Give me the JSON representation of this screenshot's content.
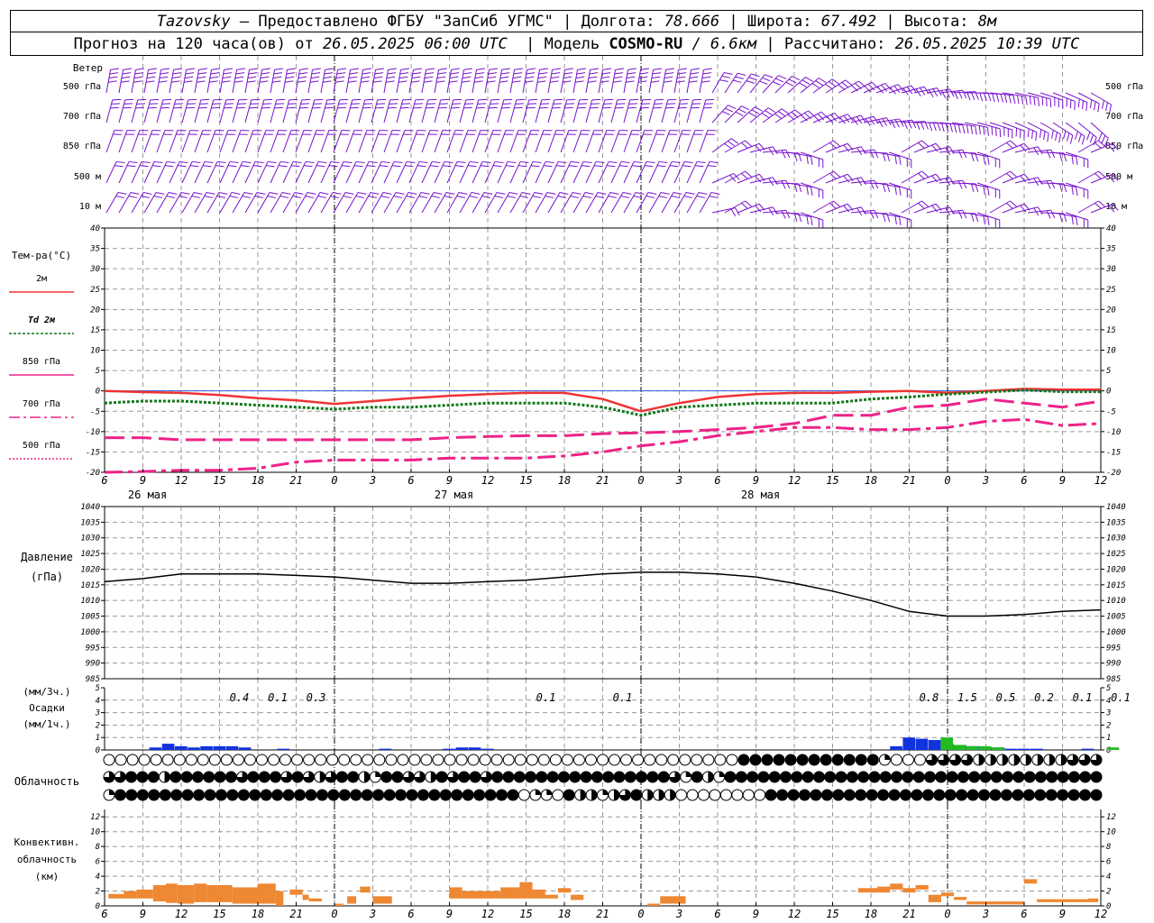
{
  "header": {
    "station": "Tazovsky",
    "provided_by": "– Предоставлено ФГБУ \"ЗапСиб УГМС\"",
    "lon_label": "Долгота:",
    "lon_value": "78.666",
    "lat_label": "Широта:",
    "lat_value": "67.492",
    "alt_label": "Высота:",
    "alt_value": "8м",
    "forecast_label": "Прогноз на 120 часа(ов) от",
    "forecast_start": "26.05.2025 06:00 UTC",
    "model_label": "Модель",
    "model_name": "COSMO-RU",
    "model_res": "/ 6.6км",
    "calc_label": "Рассчитано:",
    "calc_time": "26.05.2025 10:39 UTC"
  },
  "colors": {
    "t2m": "#ee3333",
    "td2m": "#11771a",
    "t_upper": "#ee2288",
    "wind": "#7711cc",
    "pressure": "#000000",
    "precip_3h": "#1133dd",
    "precip_1h": "#22bb22",
    "convective": "#ee8833"
  },
  "chart_data": [
    {
      "type": "wind_barbs",
      "title": "Ветер",
      "levels": [
        "500 гПа",
        "700 гПа",
        "850 гПа",
        "500 м",
        "10  м"
      ]
    },
    {
      "type": "line",
      "title": "Тем-ра(°C)",
      "ylim": [
        -20,
        40
      ],
      "yticks": [
        -20,
        -15,
        -10,
        -5,
        0,
        5,
        10,
        15,
        20,
        25,
        30,
        35,
        40
      ],
      "xtick_labels": [
        "6",
        "9",
        "12",
        "15",
        "18",
        "21",
        "0",
        "3",
        "6",
        "9",
        "12",
        "15",
        "18",
        "21",
        "0",
        "3",
        "6",
        "9",
        "12",
        "15",
        "18",
        "21",
        "0",
        "3",
        "6",
        "9",
        "12"
      ],
      "day_labels": [
        "26 мая",
        "27 мая",
        "28 мая"
      ],
      "x_hours": [
        0,
        3,
        6,
        9,
        12,
        15,
        18,
        21,
        24,
        27,
        30,
        33,
        36,
        39,
        42,
        45,
        48,
        51,
        54,
        57,
        60,
        63,
        66,
        69,
        72,
        75,
        78
      ],
      "series": [
        {
          "name": "2м",
          "values": [
            0,
            -0.3,
            -0.5,
            -1,
            -1.8,
            -2.3,
            -3.2,
            -2.5,
            -1.8,
            -1.2,
            -0.8,
            -0.5,
            -0.5,
            -2,
            -5,
            -3,
            -1.5,
            -0.8,
            -0.5,
            -0.5,
            -0.2,
            0,
            -0.5,
            0,
            0.5,
            0.3,
            0.3
          ]
        },
        {
          "name": "Td 2м",
          "values": [
            -3,
            -2.5,
            -2.5,
            -3,
            -3.5,
            -4,
            -4.5,
            -4,
            -4,
            -3.5,
            -3,
            -3,
            -3,
            -4,
            -6,
            -4,
            -3.5,
            -3,
            -3,
            -3,
            -2,
            -1.5,
            -0.8,
            -0.3,
            0.2,
            -0.2,
            -0.2
          ]
        },
        {
          "name": "850 гПа",
          "values": [
            -11.5,
            -11.5,
            -12,
            -12,
            -12,
            -12,
            -12,
            -12,
            -12,
            -11.5,
            -11.2,
            -11,
            -11,
            -10.5,
            -10.3,
            -10,
            -9.5,
            -9,
            -8,
            -6,
            -6,
            -4,
            -3.5,
            -2,
            -3,
            -4,
            -2.5
          ]
        },
        {
          "name": "700 гПа",
          "values": [
            -20,
            -19.8,
            -19.5,
            -19.5,
            -19,
            -17.5,
            -17,
            -17,
            -17,
            -16.5,
            -16.5,
            -16.5,
            -16,
            -15,
            -13.5,
            -12.5,
            -11,
            -10,
            -9,
            -9,
            -9.5,
            -9.5,
            -9,
            -7.5,
            -7,
            -8.5,
            -8
          ]
        },
        {
          "name": "500 гПа",
          "values": []
        }
      ]
    },
    {
      "type": "line",
      "title": "Давление",
      "ylabel": "(гПа)",
      "ylim": [
        985,
        1040
      ],
      "yticks": [
        985,
        990,
        995,
        1000,
        1005,
        1010,
        1015,
        1020,
        1025,
        1030,
        1035,
        1040
      ],
      "series": [
        {
          "name": "",
          "values": [
            1016,
            1017,
            1018.5,
            1018.5,
            1018.5,
            1018,
            1017.5,
            1016.5,
            1015.5,
            1015.5,
            1016,
            1016.5,
            1017.5,
            1018.5,
            1019,
            1019,
            1018.5,
            1017.5,
            1015.5,
            1013,
            1010,
            1006.5,
            1005,
            1005,
            1005.5,
            1006.5,
            1007
          ]
        }
      ]
    },
    {
      "type": "bar",
      "title": "Осадки",
      "ylabel_3h": "(мм/3ч.)",
      "ylabel_1h": "(мм/1ч.)",
      "ylim": [
        0,
        5
      ],
      "yticks": [
        0,
        1,
        2,
        3,
        4,
        5
      ],
      "labels": [
        {
          "hour": 9,
          "text": "0.4"
        },
        {
          "hour": 12,
          "text": "0.1"
        },
        {
          "hour": 15,
          "text": "0.3"
        },
        {
          "hour": 33,
          "text": "0.1"
        },
        {
          "hour": 39,
          "text": "0.1"
        },
        {
          "hour": 63,
          "text": "0.8"
        },
        {
          "hour": 66,
          "text": "1.5"
        },
        {
          "hour": 69,
          "text": "0.5"
        },
        {
          "hour": 72,
          "text": "0.2"
        },
        {
          "hour": 75,
          "text": "0.1"
        },
        {
          "hour": 78,
          "text": "0.1"
        }
      ],
      "bars_3h": [
        {
          "hour": 4,
          "value": 0.2
        },
        {
          "hour": 5,
          "value": 0.5
        },
        {
          "hour": 6,
          "value": 0.3
        },
        {
          "hour": 7,
          "value": 0.2
        },
        {
          "hour": 8,
          "value": 0.3
        },
        {
          "hour": 9,
          "value": 0.3
        },
        {
          "hour": 10,
          "value": 0.3
        },
        {
          "hour": 11,
          "value": 0.2
        },
        {
          "hour": 14,
          "value": 0.1
        },
        {
          "hour": 22,
          "value": 0.1
        },
        {
          "hour": 27,
          "value": 0.1
        },
        {
          "hour": 28,
          "value": 0.2
        },
        {
          "hour": 29,
          "value": 0.2
        },
        {
          "hour": 30,
          "value": 0.1
        },
        {
          "hour": 62,
          "value": 0.3
        },
        {
          "hour": 63,
          "value": 1.0
        },
        {
          "hour": 64,
          "value": 0.9
        },
        {
          "hour": 65,
          "value": 0.8
        },
        {
          "hour": 66,
          "value": 0.5
        },
        {
          "hour": 67,
          "value": 0.4
        },
        {
          "hour": 68,
          "value": 0.3
        },
        {
          "hour": 69,
          "value": 0.2
        },
        {
          "hour": 70,
          "value": 0.2
        },
        {
          "hour": 71,
          "value": 0.1
        },
        {
          "hour": 72,
          "value": 0.1
        },
        {
          "hour": 73,
          "value": 0.1
        },
        {
          "hour": 77,
          "value": 0.1
        }
      ],
      "bars_1h": [
        {
          "hour": 65,
          "value": 1.0
        },
        {
          "hour": 66,
          "value": 0.4
        },
        {
          "hour": 67,
          "value": 0.3
        },
        {
          "hour": 68,
          "value": 0.3
        },
        {
          "hour": 69,
          "value": 0.2
        },
        {
          "hour": 78,
          "value": 0.2
        }
      ]
    },
    {
      "type": "cloud_symbols",
      "title": "Облачность",
      "rows": [
        "000000000000000000000000000000000000000000000000000000FFFFFFFFFFFFQ000TTTTHHHHHHHHTTT",
        "TTFFFHFFFFFFTFFFTFTHTFFHQFFTTHFTFFTFFFFFFFFFFFFFFFFTQFHQFFFFFFFFFFFFFFFFFFFFFFFFFFFFFFFFFF",
        "QFFFFFFFFFFFFFFFFFFFFFFFFFFFFFFFFFFFF0QQ0FHHQHTFHHH00000000FFFFFFFFFFFFFFFFFFFFFFFFFFFFFF"
      ]
    },
    {
      "type": "bar",
      "title": "Конвективн. облачность",
      "ylabel": "(км)",
      "ylim": [
        0,
        13
      ],
      "yticks": [
        0,
        2,
        4,
        6,
        8,
        10,
        12
      ],
      "segments": [
        {
          "h0": 0.3,
          "h1": 1.5,
          "lo": 1.0,
          "hi": 1.6
        },
        {
          "h0": 1.5,
          "h1": 2.5,
          "lo": 1.0,
          "hi": 2.0
        },
        {
          "h0": 2.5,
          "h1": 3.8,
          "lo": 1.0,
          "hi": 2.2
        },
        {
          "h0": 3.8,
          "h1": 4.8,
          "lo": 0.6,
          "hi": 2.8
        },
        {
          "h0": 4.8,
          "h1": 5.7,
          "lo": 0.4,
          "hi": 3.0
        },
        {
          "h0": 5.7,
          "h1": 7.0,
          "lo": 0.3,
          "hi": 2.8
        },
        {
          "h0": 7.0,
          "h1": 8.0,
          "lo": 0.5,
          "hi": 3.0
        },
        {
          "h0": 8.0,
          "h1": 10.0,
          "lo": 0.5,
          "hi": 2.8
        },
        {
          "h0": 10.0,
          "h1": 12.0,
          "lo": 0.3,
          "hi": 2.5
        },
        {
          "h0": 12.0,
          "h1": 13.4,
          "lo": 0.3,
          "hi": 3.0
        },
        {
          "h0": 13.4,
          "h1": 14.0,
          "lo": 0.0,
          "hi": 2.0
        },
        {
          "h0": 14.5,
          "h1": 15.5,
          "lo": 1.5,
          "hi": 2.2
        },
        {
          "h0": 15.5,
          "h1": 16.0,
          "lo": 0.8,
          "hi": 1.5
        },
        {
          "h0": 16.0,
          "h1": 17.0,
          "lo": 0.6,
          "hi": 1.0
        },
        {
          "h0": 18.0,
          "h1": 18.7,
          "lo": 0.0,
          "hi": 0.3
        },
        {
          "h0": 19.0,
          "h1": 19.7,
          "lo": 0.3,
          "hi": 1.3
        },
        {
          "h0": 20.0,
          "h1": 20.8,
          "lo": 1.8,
          "hi": 2.6
        },
        {
          "h0": 21.0,
          "h1": 22.5,
          "lo": 0.3,
          "hi": 1.3
        },
        {
          "h0": 27.0,
          "h1": 28.0,
          "lo": 1.0,
          "hi": 2.5
        },
        {
          "h0": 28.0,
          "h1": 31.0,
          "lo": 1.0,
          "hi": 2.0
        },
        {
          "h0": 31.0,
          "h1": 32.5,
          "lo": 1.0,
          "hi": 2.5
        },
        {
          "h0": 32.5,
          "h1": 33.5,
          "lo": 1.0,
          "hi": 3.2
        },
        {
          "h0": 33.5,
          "h1": 34.5,
          "lo": 1.0,
          "hi": 2.2
        },
        {
          "h0": 34.5,
          "h1": 35.5,
          "lo": 1.0,
          "hi": 1.5
        },
        {
          "h0": 35.5,
          "h1": 36.5,
          "lo": 1.8,
          "hi": 2.4
        },
        {
          "h0": 36.5,
          "h1": 37.5,
          "lo": 0.8,
          "hi": 1.5
        },
        {
          "h0": 42.5,
          "h1": 43.5,
          "lo": 0.0,
          "hi": 0.3
        },
        {
          "h0": 43.5,
          "h1": 45.5,
          "lo": 0.3,
          "hi": 1.3
        },
        {
          "h0": 59.0,
          "h1": 60.5,
          "lo": 1.8,
          "hi": 2.4
        },
        {
          "h0": 60.5,
          "h1": 61.5,
          "lo": 1.8,
          "hi": 2.6
        },
        {
          "h0": 61.5,
          "h1": 62.5,
          "lo": 2.2,
          "hi": 3.0
        },
        {
          "h0": 62.5,
          "h1": 63.5,
          "lo": 1.8,
          "hi": 2.4
        },
        {
          "h0": 63.5,
          "h1": 64.5,
          "lo": 2.2,
          "hi": 2.8
        },
        {
          "h0": 64.5,
          "h1": 65.5,
          "lo": 0.5,
          "hi": 1.5
        },
        {
          "h0": 65.5,
          "h1": 66.5,
          "lo": 1.3,
          "hi": 1.8
        },
        {
          "h0": 66.5,
          "h1": 67.5,
          "lo": 0.8,
          "hi": 1.2
        },
        {
          "h0": 67.5,
          "h1": 70.5,
          "lo": 0.2,
          "hi": 0.6
        },
        {
          "h0": 70.5,
          "h1": 72.0,
          "lo": 0.2,
          "hi": 0.6
        },
        {
          "h0": 72.0,
          "h1": 73.0,
          "lo": 3.0,
          "hi": 3.6
        },
        {
          "h0": 73.0,
          "h1": 77.0,
          "lo": 0.5,
          "hi": 0.9
        },
        {
          "h0": 77.0,
          "h1": 77.8,
          "lo": 0.5,
          "hi": 1.0
        }
      ]
    }
  ]
}
